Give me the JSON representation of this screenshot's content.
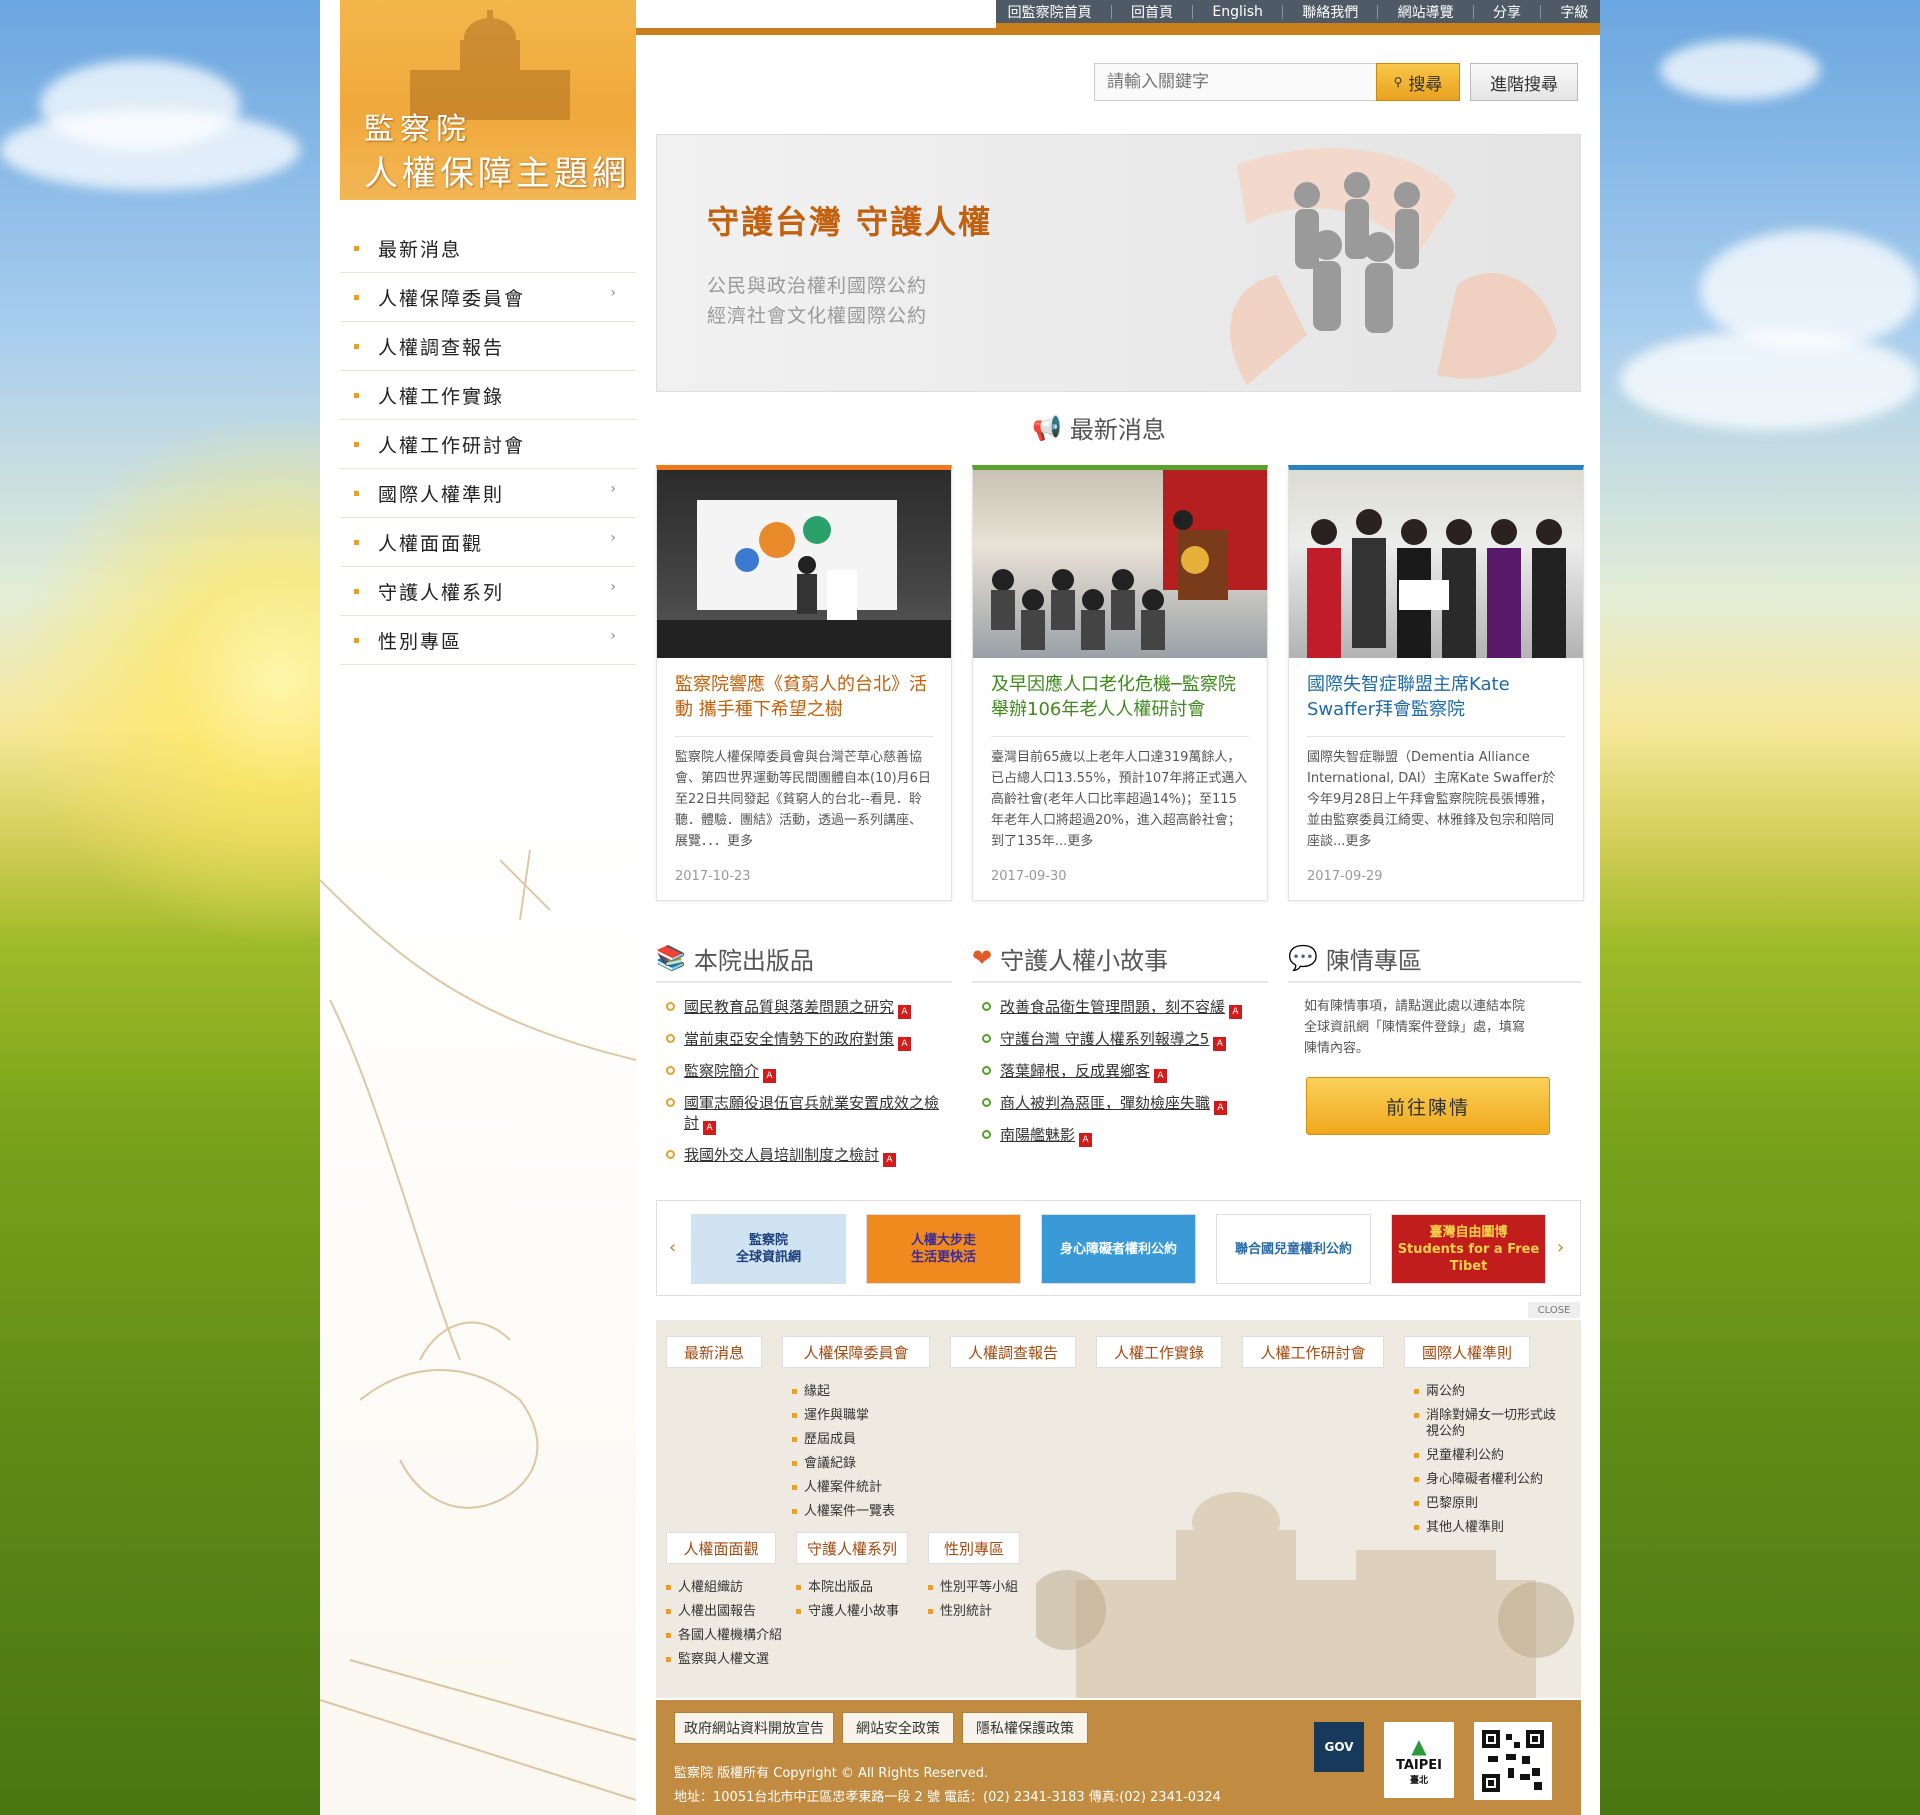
{
  "topbar": {
    "items": [
      "回監察院首頁",
      "回首頁",
      "English",
      "聯絡我們",
      "網站導覽",
      "分享",
      "字級"
    ]
  },
  "logo": {
    "line1": "監察院",
    "line2": "人權保障主題網"
  },
  "nav": {
    "items": [
      {
        "label": "最新消息",
        "sub": false
      },
      {
        "label": "人權保障委員會",
        "sub": true
      },
      {
        "label": "人權調查報告",
        "sub": false
      },
      {
        "label": "人權工作實錄",
        "sub": false
      },
      {
        "label": "人權工作研討會",
        "sub": false
      },
      {
        "label": "國際人權準則",
        "sub": true
      },
      {
        "label": "人權面面觀",
        "sub": true
      },
      {
        "label": "守護人權系列",
        "sub": true
      },
      {
        "label": "性別專區",
        "sub": true
      }
    ]
  },
  "search": {
    "placeholder": "請輸入關鍵字",
    "button": "搜尋",
    "advanced": "進階搜尋"
  },
  "banner": {
    "headline": "守護台灣  守護人權",
    "line1": "公民與政治權利國際公約",
    "line2": "經濟社會文化權國際公約"
  },
  "news": {
    "title": "最新消息",
    "cards": [
      {
        "title": "監察院響應《貧窮人的台北》活動  攜手種下希望之樹",
        "text": "監察院人權保障委員會與台灣芒草心慈善協會、第四世界運動等民間團體自本(10)月6日至22日共同發起《貧窮人的台北--看見．聆聽．體驗．團結》活動，透過一系列講座、展覽．．．更多",
        "date": "2017-10-23",
        "color": "#f07a1a",
        "title_color": "#c3600d"
      },
      {
        "title": "及早因應人口老化危機─監察院舉辦106年老人人權研討會",
        "text": "臺灣目前65歲以上老年人口達319萬餘人，已占總人口13.55%，預計107年將正式邁入高齡社會(老年人口比率超過14%)；至115年老年人口將超過20%，進入超高齡社會；到了135年...更多",
        "date": "2017-09-30",
        "color": "#5aa12e",
        "title_color": "#3f8a1c"
      },
      {
        "title": "國際失智症聯盟主席Kate Swaffer拜會監察院",
        "text": "國際失智症聯盟（Dementia Alliance International, DAI）主席Kate Swaffer於今年9月28日上午拜會監察院院長張博雅，並由監察委員江綺雯、林雅鋒及包宗和陪同座談...更多",
        "date": "2017-09-29",
        "color": "#2a83c0",
        "title_color": "#1f6aa8"
      }
    ]
  },
  "publications": {
    "title": "本院出版品",
    "items": [
      "國民教育品質與落差問題之研究",
      "當前東亞安全情勢下的政府對策",
      "監察院簡介",
      "國軍志願役退伍官兵就業安置成效之檢討",
      "我國外交人員培訓制度之檢討"
    ]
  },
  "stories": {
    "title": "守護人權小故事",
    "items": [
      "改善食品衛生管理問題，刻不容緩",
      "守護台灣 守護人權系列報導之5",
      "落葉歸根，反成異鄉客",
      "商人被判為惡匪，彈劾檢座失職",
      "南陽艦魅影"
    ]
  },
  "petition": {
    "title": "陳情專區",
    "text": "如有陳情事項，請點選此處以連結本院全球資訊網「陳情案件登錄」處，填寫陳情內容。",
    "button": "前往陳情"
  },
  "links": {
    "items": [
      {
        "label": "監察院\n全球資訊網",
        "bg": "#cfe3f3",
        "fg": "#1b3f7a"
      },
      {
        "label": "人權大步走\n生活更快活",
        "bg": "#f08a1e",
        "fg": "#3a2a9a"
      },
      {
        "label": "身心障礙者權利公約",
        "bg": "#3a9ad8",
        "fg": "#ffffff"
      },
      {
        "label": "聯合國兒童權利公約",
        "bg": "#ffffff",
        "fg": "#2a6aa8"
      },
      {
        "label": "臺灣自由圖博\nStudents for a Free Tibet",
        "bg": "#c11d1d",
        "fg": "#f7d24a"
      }
    ]
  },
  "close": "CLOSE",
  "sitemap": {
    "tabs_row1": [
      "最新消息",
      "人權保障委員會",
      "人權調查報告",
      "人權工作實錄",
      "人權工作研討會",
      "國際人權準則"
    ],
    "committee": [
      "緣起",
      "運作與職掌",
      "歷屆成員",
      "會議紀錄",
      "人權案件統計",
      "人權案件一覽表"
    ],
    "intl": [
      "兩公約",
      "消除對婦女一切形式歧視公約",
      "兒童權利公約",
      "身心障礙者權利公約",
      "巴黎原則",
      "其他人權準則"
    ],
    "tabs_row2": [
      "人權面面觀",
      "守護人權系列",
      "性別專區"
    ],
    "views": [
      "人權組織訪",
      "人權出國報告",
      "各國人權機構介紹",
      "監察與人權文選"
    ],
    "series": [
      "本院出版品",
      "守護人權小故事"
    ],
    "gender": [
      "性別平等小組",
      "性別統計"
    ]
  },
  "footer": {
    "buttons": [
      "政府網站資料開放宣告",
      "網站安全政策",
      "隱私權保護政策"
    ],
    "copyright": "監察院 版權所有 Copyright © All Rights Reserved.",
    "address": "地址：10051台北市中正區忠孝東路一段 2 號  電話：(02) 2341-3183  傳真:(02) 2341-0324",
    "gov": "GOV",
    "taipei": "TAIPEI",
    "taipei_sub": "臺北"
  }
}
